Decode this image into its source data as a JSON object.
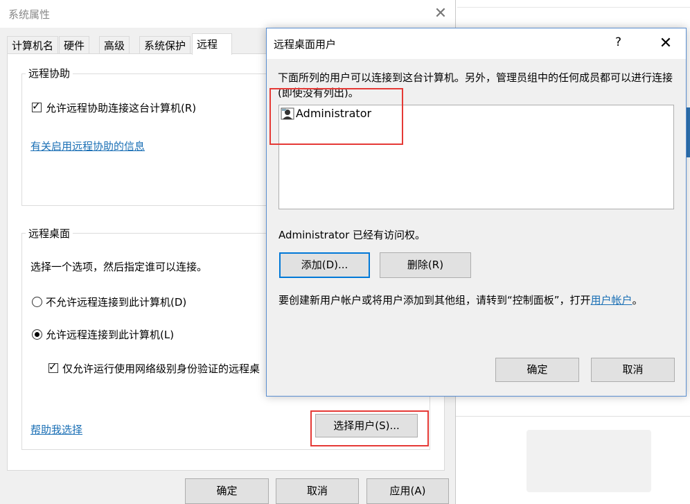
{
  "system_properties": {
    "title": "系统属性",
    "tabs": [
      {
        "label": "计算机名"
      },
      {
        "label": "硬件"
      },
      {
        "label": "高级"
      },
      {
        "label": "系统保护"
      },
      {
        "label": "远程"
      }
    ],
    "remote_assistance": {
      "group_title": "远程协助",
      "allow_checkbox_label": "允许远程协助连接这台计算机(R)",
      "allow_checked": true,
      "info_link": "有关启用远程协助的信息"
    },
    "remote_desktop": {
      "group_title": "远程桌面",
      "instruction": "选择一个选项，然后指定谁可以连接。",
      "option_deny": "不允许远程连接到此计算机(D)",
      "option_allow": "允许远程连接到此计算机(L)",
      "selected_option": "allow",
      "nla_checkbox_label": "仅允许运行使用网络级别身份验证的远程桌",
      "nla_checked": true,
      "help_link": "帮助我选择",
      "select_users_button": "选择用户(S)..."
    },
    "buttons": {
      "ok": "确定",
      "cancel": "取消",
      "apply": "应用(A)"
    }
  },
  "remote_desktop_users": {
    "title": "远程桌面用户",
    "help_glyph": "?",
    "description": "下面所列的用户可以连接到这台计算机。另外，管理员组中的任何成员都可以进行连接(即使没有列出)。",
    "users": [
      {
        "name": "Administrator"
      }
    ],
    "access_status": "Administrator 已经有访问权。",
    "add_button": "添加(D)...",
    "remove_button": "删除(R)",
    "footer_text": "要创建新用户帐户或将用户添加到其他组，请转到“控制面板”，打开",
    "footer_link": "用户帐户",
    "footer_end": "。",
    "ok_button": "确定",
    "cancel_button": "取消"
  },
  "colors": {
    "accent": "#0078d7",
    "link": "#1a6fb5",
    "highlight_box": "#e53935"
  }
}
